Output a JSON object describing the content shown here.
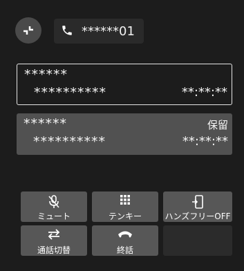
{
  "status_bar": {
    "phone_number": "******01"
  },
  "calls": [
    {
      "name": "******",
      "number": "**********",
      "duration": "**:**:**",
      "status": ""
    },
    {
      "name": "******",
      "number": "**********",
      "duration": "**:**:**",
      "status": "保留"
    }
  ],
  "controls": {
    "mute_label": "ミュート",
    "keypad_label": "テンキー",
    "handsfree_label": "ハンズフリーOFF",
    "switch_call_label": "通話切替",
    "end_call_label": "終話"
  },
  "icons": {
    "minimize": "minimize-icon",
    "phone": "phone-icon",
    "mute": "mic-mute-icon",
    "keypad": "keypad-icon",
    "handsfree": "handsfree-icon",
    "switch": "switch-arrows-icon",
    "end_call": "handset-end-icon"
  },
  "colors": {
    "accent": "#ffffff",
    "card_active_border": "#e6e6e6",
    "card_held_bg": "#515151",
    "button_bg": "#575757"
  }
}
